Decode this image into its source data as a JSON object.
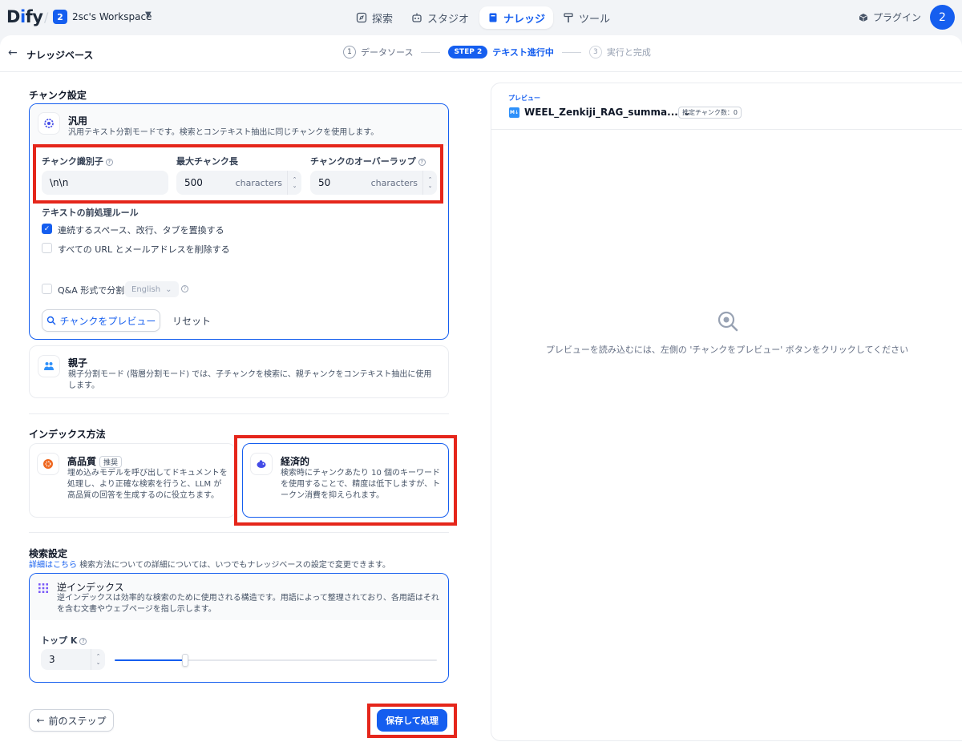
{
  "nav": {
    "logo_prefix": "D",
    "logo_accent": "i",
    "logo_suffix": "fy",
    "workspace_badge": "2",
    "workspace_name": "2sc's Workspace",
    "items": [
      {
        "label": "探索",
        "icon": "compass-icon"
      },
      {
        "label": "スタジオ",
        "icon": "robot-icon"
      },
      {
        "label": "ナレッジ",
        "icon": "book-icon",
        "active": true
      },
      {
        "label": "ツール",
        "icon": "hammer-icon"
      }
    ],
    "plugin_label": "プラグイン",
    "avatar": "2"
  },
  "header": {
    "title": "ナレッジベース",
    "steps": [
      {
        "num": "1",
        "label": "データソース"
      },
      {
        "pill": "STEP 2",
        "label": "テキスト進行中"
      },
      {
        "num": "3",
        "label": "実行と完成"
      }
    ]
  },
  "chunk": {
    "section_title": "チャンク設定",
    "general": {
      "title": "汎用",
      "desc": "汎用テキスト分割モードです。検索とコンテキスト抽出に同じチャンクを使用します。",
      "separator_label": "チャンク識別子",
      "separator_value": "\\n\\n",
      "max_label": "最大チャンク長",
      "max_value": "500",
      "max_unit": "characters",
      "overlap_label": "チャンクのオーバーラップ",
      "overlap_value": "50",
      "overlap_unit": "characters",
      "rules_title": "テキストの前処理ルール",
      "rule1": "連続するスペース、改行、タブを置換する",
      "rule1_checked": true,
      "rule2": "すべての URL とメールアドレスを削除する",
      "rule2_checked": false,
      "qa_label": "Q&A 形式で分割",
      "qa_checked": false,
      "qa_language": "English",
      "preview_button": "チャンクをプレビュー",
      "reset_button": "リセット"
    },
    "parent": {
      "title": "親子",
      "desc": "親子分割モード (階層分割モード) では、子チャンクを検索に、親チャンクをコンテキスト抽出に使用します。"
    }
  },
  "index": {
    "section_title": "インデックス方法",
    "high": {
      "title": "高品質",
      "badge": "推奨",
      "desc": "埋め込みモデルを呼び出してドキュメントを処理し、より正確な検索を行うと、LLM が高品質の回答を生成するのに役立ちます。"
    },
    "economy": {
      "title": "経済的",
      "desc": "検索時にチャンクあたり 10 個のキーワードを使用することで、精度は低下しますが、トークン消費を抑えられます。"
    }
  },
  "retrieval": {
    "section_title": "検索設定",
    "link_text": "詳細はこちら",
    "note": "検索方法についての詳細については、いつでもナレッジベースの設定で変更できます。",
    "method_title": "逆インデックス",
    "method_desc": "逆インデックスは効率的な検索のために使用される構造です。用語によって整理されており、各用語はそれを含む文書やウェブページを指し示します。",
    "topk_label": "トップ K",
    "topk_value": "3",
    "topk_slider_fraction": 0.22
  },
  "footer": {
    "prev_button": "前のステップ",
    "save_button": "保存して処理"
  },
  "preview": {
    "label": "プレビュー",
    "file_name": "WEEL_Zenkiji_RAG_summa...",
    "file_icon_text": "M↓",
    "count_label": "推定チャンク数：0",
    "empty_text": "プレビューを読み込むには、左側の 'チャンクをプレビュー' ボタンをクリックしてください"
  },
  "colors": {
    "accent": "#155eef",
    "highlight_box": "#e5261b"
  }
}
